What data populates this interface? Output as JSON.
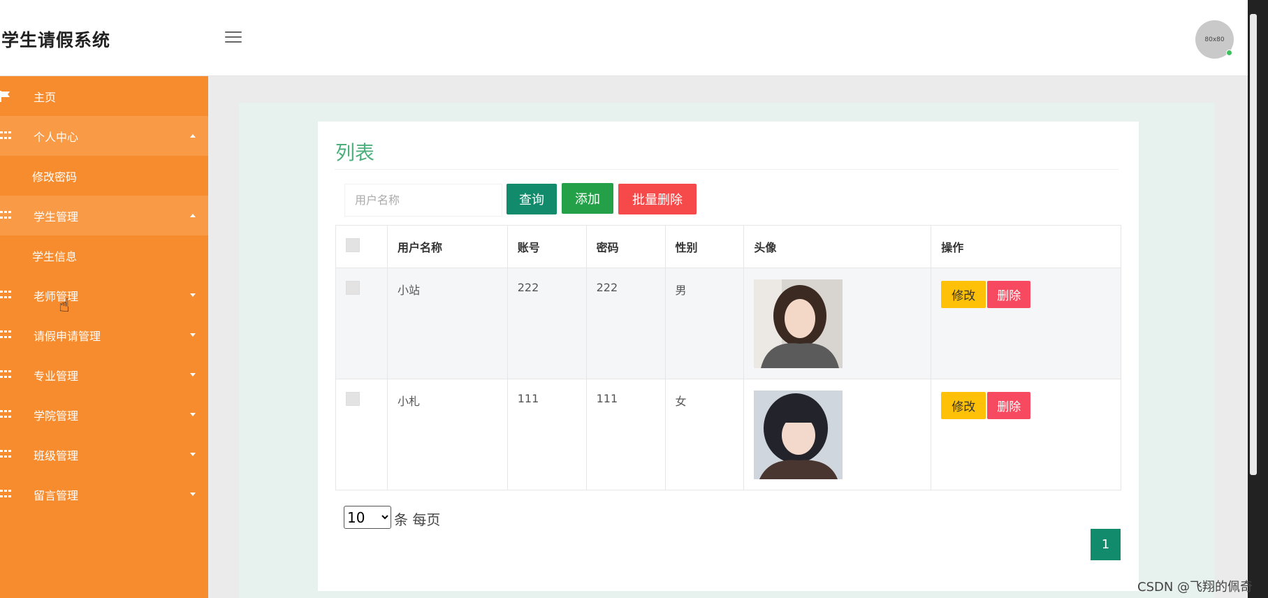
{
  "header": {
    "brand": "学生请假系统",
    "avatar_text": "80x80"
  },
  "sidebar": {
    "items": [
      {
        "label": "主页",
        "icon": "flag-icon",
        "expanded": false
      },
      {
        "label": "个人中心",
        "icon": "grid-icon",
        "expanded": true,
        "children": [
          "修改密码"
        ]
      },
      {
        "label": "学生管理",
        "icon": "grid-icon",
        "expanded": true,
        "children": [
          "学生信息"
        ]
      },
      {
        "label": "老师管理",
        "icon": "grid-icon",
        "expanded": false
      },
      {
        "label": "请假申请管理",
        "icon": "grid-icon",
        "expanded": false
      },
      {
        "label": "专业管理",
        "icon": "grid-icon",
        "expanded": false
      },
      {
        "label": "学院管理",
        "icon": "grid-icon",
        "expanded": false
      },
      {
        "label": "班级管理",
        "icon": "grid-icon",
        "expanded": false
      },
      {
        "label": "留言管理",
        "icon": "grid-icon",
        "expanded": false
      }
    ]
  },
  "main": {
    "title": "列表",
    "search": {
      "placeholder": "用户名称",
      "value": ""
    },
    "buttons": {
      "query": "查询",
      "add": "添加",
      "batch_delete": "批量删除"
    },
    "table": {
      "headers": [
        "",
        "用户名称",
        "账号",
        "密码",
        "性别",
        "头像",
        "操作"
      ],
      "rows": [
        {
          "name": "小站",
          "account": "222",
          "password": "222",
          "gender": "男"
        },
        {
          "name": "小札",
          "account": "111",
          "password": "111",
          "gender": "女"
        }
      ],
      "row_actions": {
        "edit": "修改",
        "delete": "删除"
      }
    },
    "pager": {
      "page_size": "10",
      "page_size_label": "条 每页",
      "current_page": "1"
    }
  },
  "watermark": "CSDN @飞翔的佩奇",
  "colors": {
    "sidebar": "#f78c2f",
    "primary": "#128a6c",
    "success": "#24a148",
    "danger": "#f64a4a",
    "warning": "#ffc107",
    "title": "#4caf7d"
  }
}
